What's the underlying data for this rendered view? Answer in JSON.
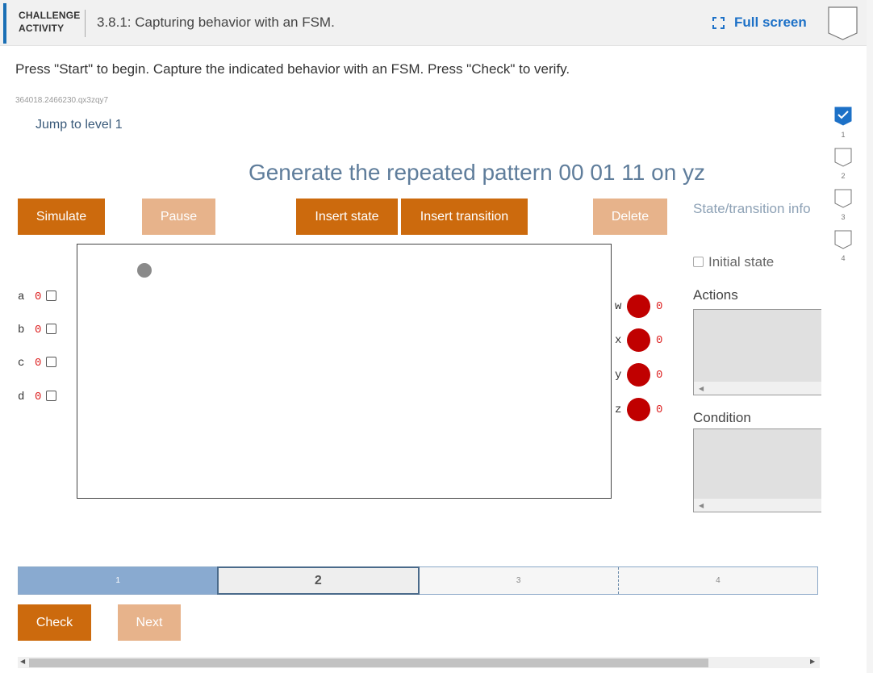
{
  "header": {
    "activity_type": "CHALLENGE ACTIVITY",
    "activity_line1": "CHALLENGE",
    "activity_line2": "ACTIVITY",
    "title": "3.8.1: Capturing behavior with an FSM.",
    "fullscreen_label": "Full screen",
    "accent_color": "#1a6fb5"
  },
  "instructions": "Press \"Start\" to begin. Capture the indicated behavior with an FSM. Press \"Check\" to verify.",
  "activity_code": "364018.2466230.qx3zqy7",
  "jump_link": "Jump to level 1",
  "levels": [
    {
      "num": "1",
      "completed": true
    },
    {
      "num": "2",
      "completed": false
    },
    {
      "num": "3",
      "completed": false
    },
    {
      "num": "4",
      "completed": false
    }
  ],
  "prompt": "Generate the repeated pattern 00 01 11 on yz",
  "toolbar": {
    "simulate": "Simulate",
    "pause": "Pause",
    "insert_state": "Insert state",
    "insert_transition": "Insert transition",
    "delete": "Delete"
  },
  "inputs": [
    {
      "name": "a",
      "value": "0"
    },
    {
      "name": "b",
      "value": "0"
    },
    {
      "name": "c",
      "value": "0"
    },
    {
      "name": "d",
      "value": "0"
    }
  ],
  "outputs": [
    {
      "name": "w",
      "value": "0"
    },
    {
      "name": "x",
      "value": "0"
    },
    {
      "name": "y",
      "value": "0"
    },
    {
      "name": "z",
      "value": "0"
    }
  ],
  "info_panel": {
    "heading": "State/transition info",
    "initial_state": "Initial state",
    "actions": "Actions",
    "condition": "Condition"
  },
  "progress": {
    "segments": [
      "1",
      "2",
      "3",
      "4"
    ],
    "current": "2"
  },
  "footer": {
    "check": "Check",
    "next": "Next"
  },
  "colors": {
    "button_active": "#cc6a0d",
    "button_disabled": "#e7b38b",
    "led_off": "#c00000",
    "link": "#1d71c7"
  }
}
